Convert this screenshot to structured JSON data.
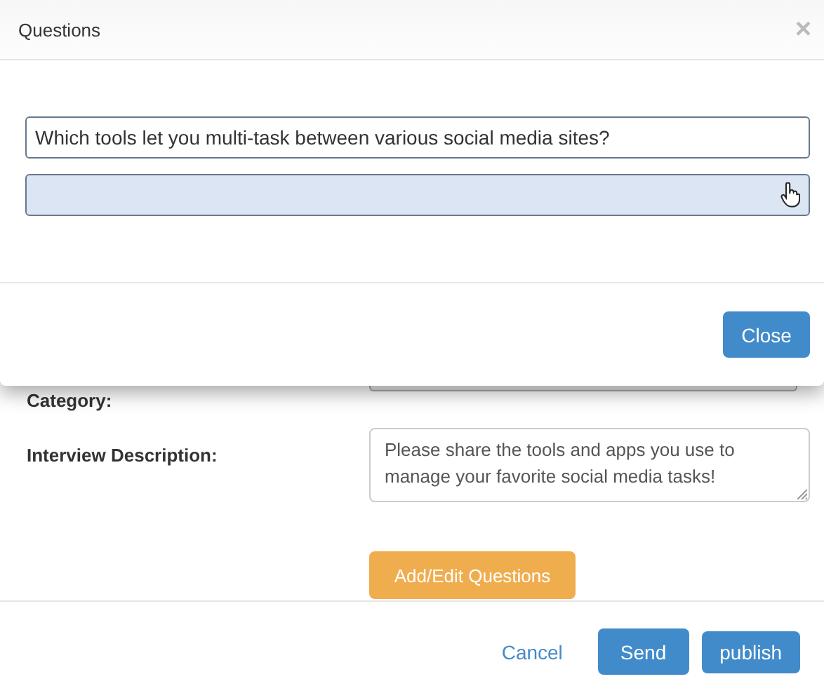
{
  "modal": {
    "title": "Questions",
    "close_glyph": "×",
    "questions": [
      {
        "value": "Which tools let you multi-task between various social media sites?",
        "highlighted": false
      },
      {
        "highlighted": true
      }
    ],
    "close_button": "Close"
  },
  "form": {
    "fields": [
      {
        "kind": "select",
        "label": "Category:"
      },
      {
        "kind": "textarea",
        "label": "Interview Description:",
        "value": "Please share the tools and apps you use to manage your favorite social media tasks!"
      }
    ],
    "add_edit_button": "Add/Edit Questions"
  },
  "footer": {
    "cancel": "Cancel",
    "buttons": [
      "Send",
      "publish"
    ]
  }
}
